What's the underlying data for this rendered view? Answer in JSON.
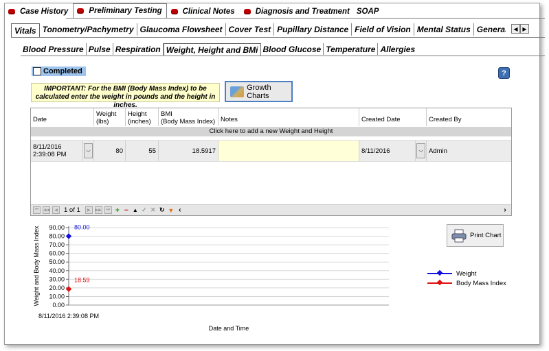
{
  "top_tabs": [
    {
      "label": "Case History",
      "icon": "red-record-icon",
      "selected": false
    },
    {
      "label": "Preliminary Testing",
      "icon": "red-record-icon",
      "selected": true
    },
    {
      "label": "Clinical Notes",
      "icon": "red-record-icon",
      "selected": false
    },
    {
      "label": "Diagnosis and Treatment",
      "icon": "red-record-icon",
      "selected": false
    },
    {
      "label": "SOAP",
      "icon": "",
      "selected": false
    }
  ],
  "secondary_tabs": [
    {
      "label": "Vitals",
      "selected": true
    },
    {
      "label": "Tonometry/Pachymetry"
    },
    {
      "label": "Glaucoma Flowsheet"
    },
    {
      "label": "Cover Test"
    },
    {
      "label": "Pupillary Distance"
    },
    {
      "label": "Field of Vision"
    },
    {
      "label": "Mental Status"
    },
    {
      "label": "General Medical Observatio"
    }
  ],
  "vitals_tabs": [
    {
      "label": "Blood Pressure"
    },
    {
      "label": "Pulse"
    },
    {
      "label": "Respiration"
    },
    {
      "label": "Weight, Height and BMi",
      "selected": true
    },
    {
      "label": "Blood Glucose"
    },
    {
      "label": "Temperature"
    },
    {
      "label": "Allergies"
    }
  ],
  "completed_label": "Completed",
  "help_label": "?",
  "important_note": "IMPORTANT: For the BMI (Body Mass Index) to be calculated enter the weight in pounds and the height in inches.",
  "growth_charts_label": "Growth Charts",
  "grid": {
    "headers": [
      "Date",
      "Weight\n(lbs)",
      "Height\n(inches)",
      "BMI\n(Body Mass Index)",
      "Notes",
      "Created Date",
      "Created By"
    ],
    "add_row_text": "Click here to add a new Weight and Height",
    "rows": [
      {
        "date": "8/11/2016 2:39:08 PM",
        "weight": "80",
        "height": "55",
        "bmi": "18.5917",
        "notes": "",
        "created_date": "8/11/2016",
        "created_by": "Admin"
      }
    ],
    "pager_text": "1 of 1"
  },
  "print_chart_label": "Print Chart",
  "chart_data": {
    "type": "line",
    "title": "",
    "xlabel": "Date and Time",
    "ylabel": "Weight and Body Mass Index",
    "ylim": [
      0,
      90
    ],
    "yticks": [
      "90.00",
      "80.00",
      "70.00",
      "60.00",
      "50.00",
      "40.00",
      "30.00",
      "20.00",
      "10.00",
      "0.00"
    ],
    "x": [
      "8/11/2016 2:39:08 PM"
    ],
    "series": [
      {
        "name": "Weight",
        "values": [
          80
        ],
        "data_labels": [
          "80.00"
        ],
        "color": "#1010e0"
      },
      {
        "name": "Body Mass Index",
        "values": [
          18.59
        ],
        "data_labels": [
          "18.59"
        ],
        "color": "#e01010"
      }
    ],
    "legend_position": "right",
    "grid": true
  }
}
